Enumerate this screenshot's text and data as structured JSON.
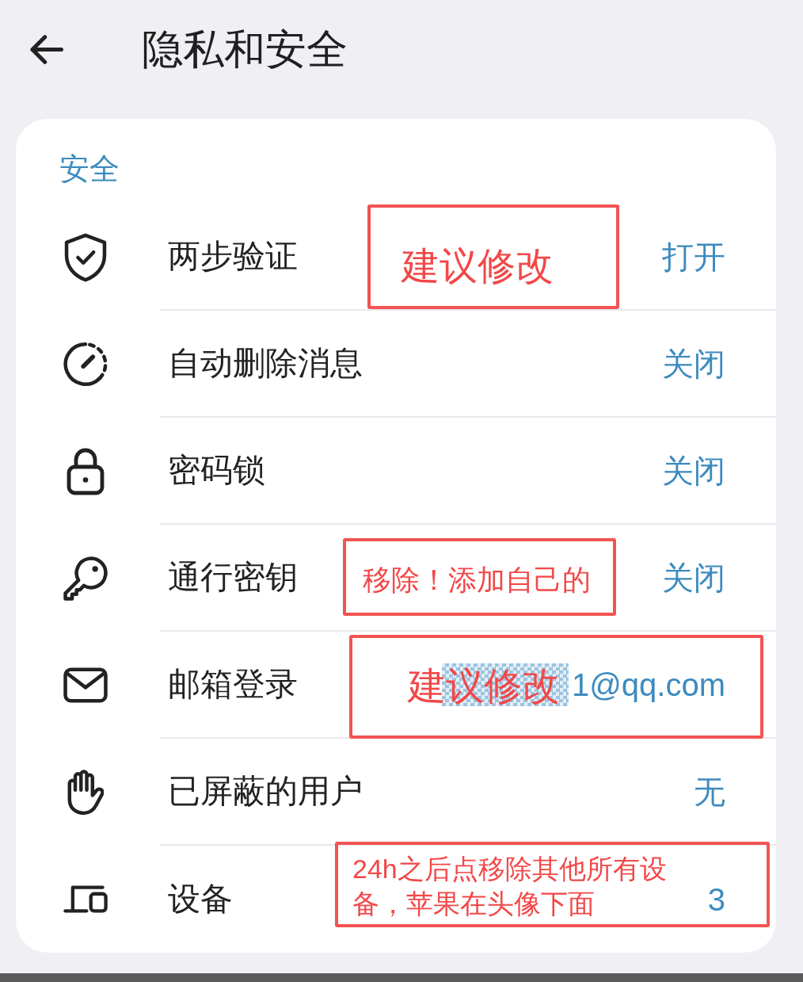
{
  "header": {
    "title": "隐私和安全"
  },
  "section": {
    "title": "安全",
    "rows": [
      {
        "kind": "shield",
        "label": "两步验证",
        "value": "打开",
        "redacted": false
      },
      {
        "kind": "timer",
        "label": "自动删除消息",
        "value": "关闭",
        "redacted": false
      },
      {
        "kind": "lock",
        "label": "密码锁",
        "value": "关闭",
        "redacted": false
      },
      {
        "kind": "key",
        "label": "通行密钥",
        "value": "关闭",
        "redacted": false
      },
      {
        "kind": "envelope",
        "label": "邮箱登录",
        "value": "1@qq.com",
        "redacted": true
      },
      {
        "kind": "hand",
        "label": "已屏蔽的用户",
        "value": "无",
        "redacted": false
      },
      {
        "kind": "devices",
        "label": "设备",
        "value": "3",
        "redacted": false
      }
    ]
  },
  "annotations": [
    {
      "text": "建议修改"
    },
    {
      "text": "移除！添加自己的"
    },
    {
      "text": "建议修改"
    },
    {
      "text": "24h之后点移除其他所有设备，苹果在头像下面"
    }
  ]
}
